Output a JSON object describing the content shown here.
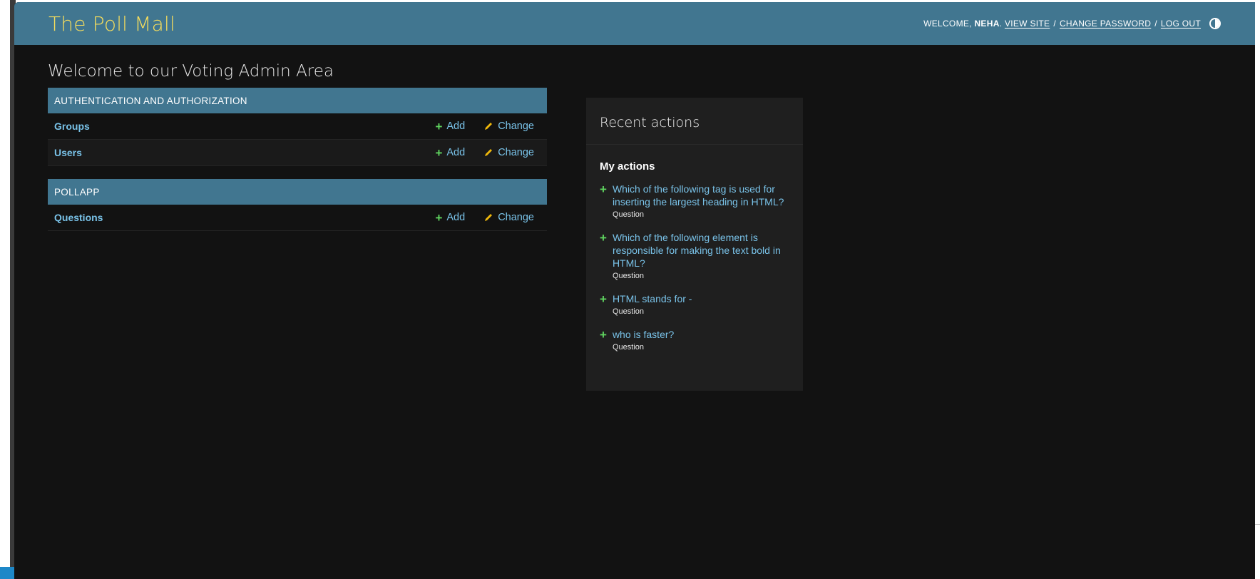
{
  "header": {
    "site_name": "The Poll Mall",
    "welcome_label": "Welcome,",
    "username": "Neha",
    "view_site": "View site",
    "separator": "/",
    "change_password": "Change password",
    "log_out": "Log out"
  },
  "page_title": "Welcome to our Voting Admin Area",
  "apps": [
    {
      "caption": "Authentication and Authorization",
      "models": [
        {
          "name": "Groups",
          "add": "Add",
          "change": "Change"
        },
        {
          "name": "Users",
          "add": "Add",
          "change": "Change"
        }
      ]
    },
    {
      "caption": "Pollapp",
      "models": [
        {
          "name": "Questions",
          "add": "Add",
          "change": "Change"
        }
      ]
    }
  ],
  "recent_actions": {
    "title": "Recent actions",
    "subtitle": "My actions",
    "items": [
      {
        "text": "Which of the following tag is used for inserting the largest heading in HTML?",
        "type": "Question"
      },
      {
        "text": "Which of the following element is responsible for making the text bold in HTML?",
        "type": "Question"
      },
      {
        "text": "HTML stands for -",
        "type": "Question"
      },
      {
        "text": "who is faster?",
        "type": "Question"
      }
    ]
  },
  "colors": {
    "header_bg": "#417690",
    "site_name": "#f5dd5d",
    "link": "#79c2e8",
    "add_icon": "#5fd35f",
    "change_icon": "#efb80b",
    "page_bg": "#121212"
  }
}
